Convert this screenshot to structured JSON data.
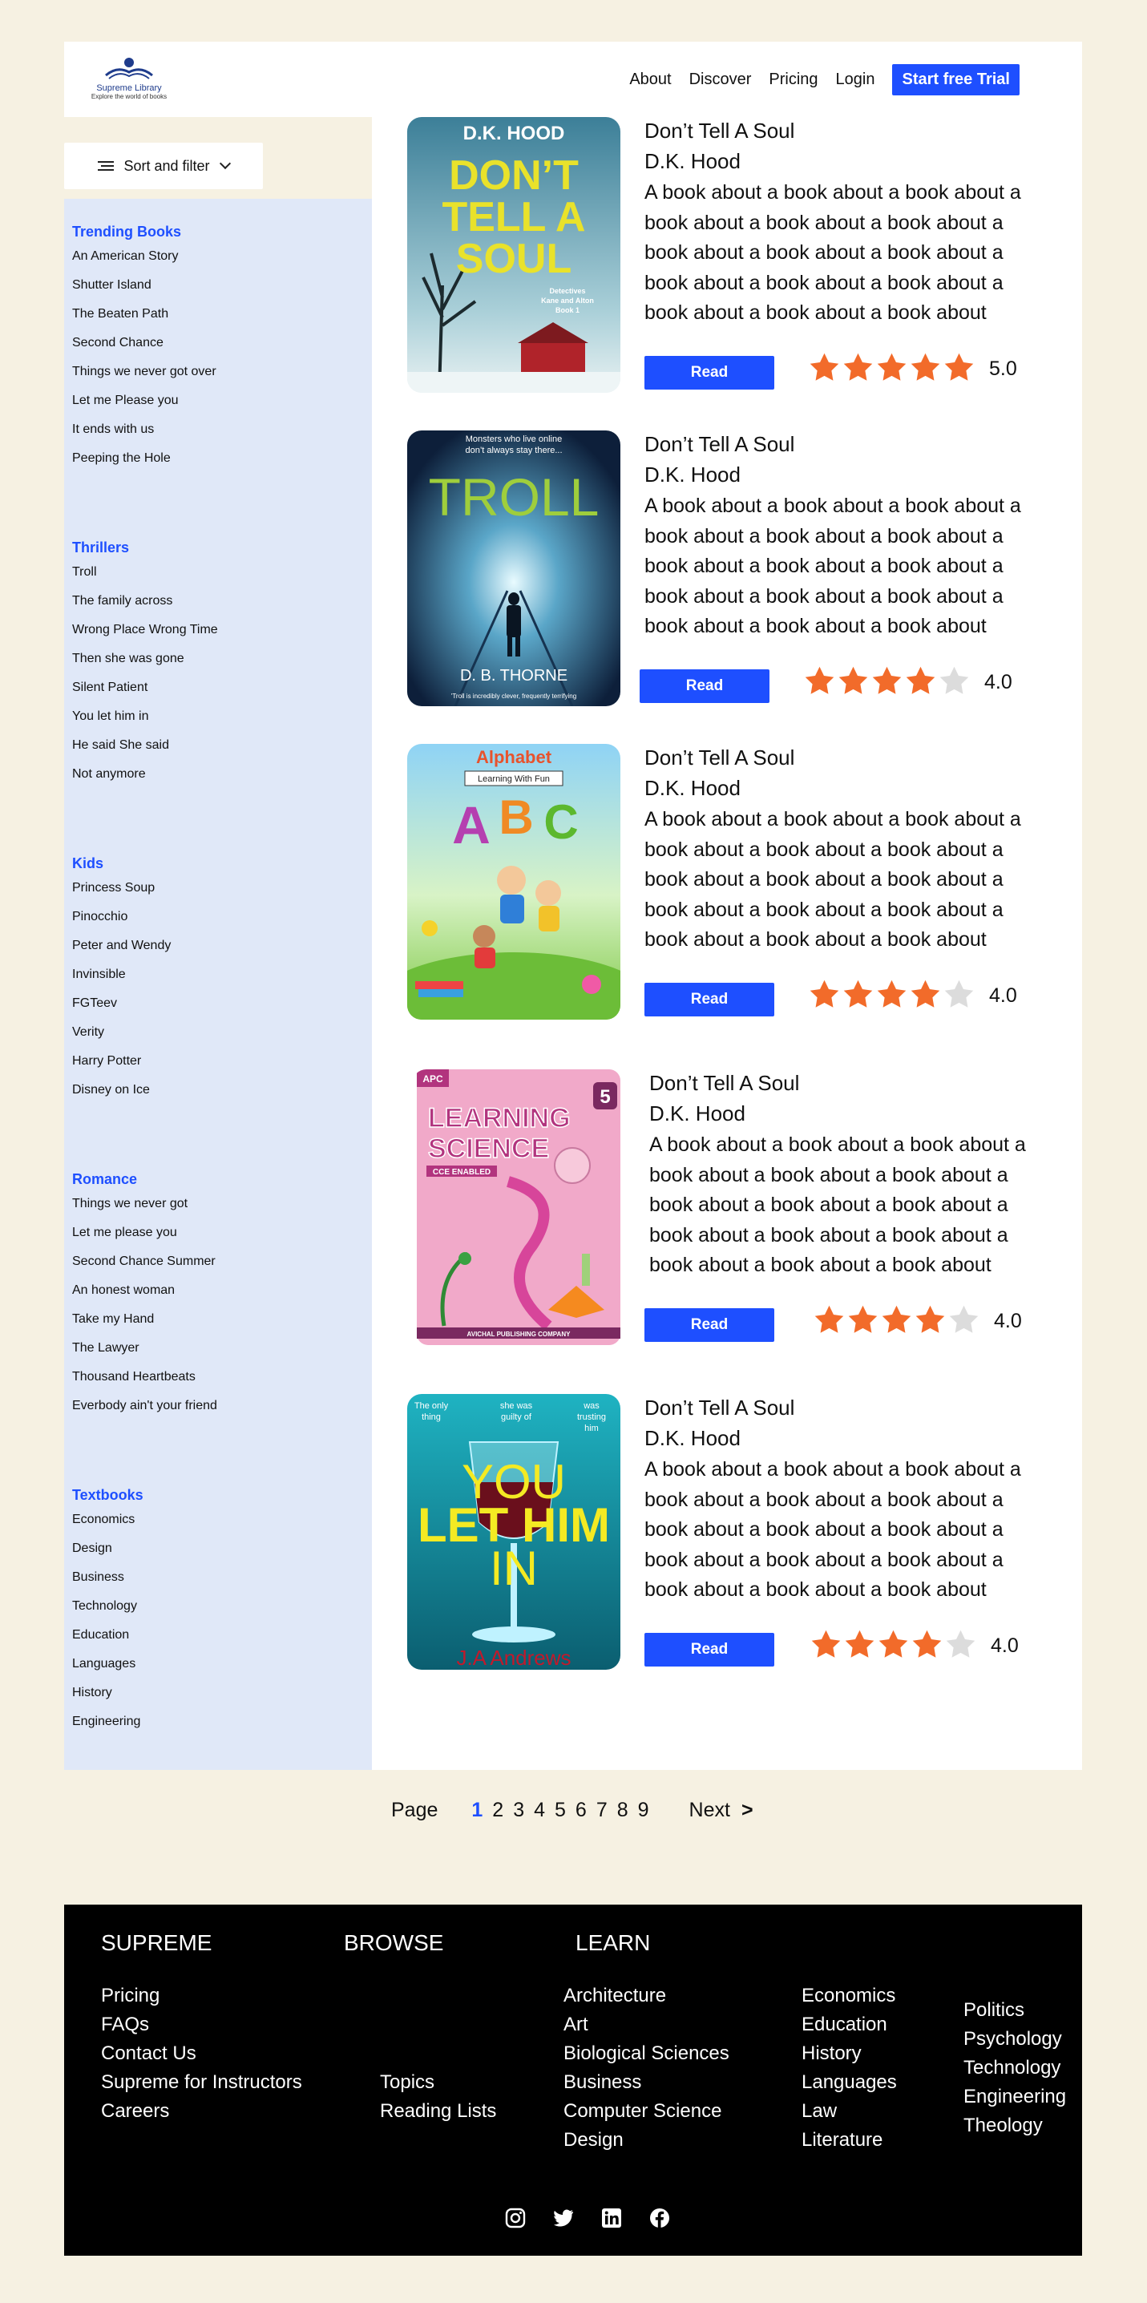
{
  "header": {
    "logo_name": "Supreme Library",
    "logo_tagline": "Explore the world of books",
    "nav": [
      "About",
      "Discover",
      "Pricing",
      "Login"
    ],
    "cta": "Start free Trial"
  },
  "sort": {
    "label": "Sort and filter"
  },
  "sidebar": {
    "categories": [
      {
        "title": "Trending Books",
        "items": [
          " An American Story",
          "Shutter  Island",
          "The Beaten Path",
          "Second Chance",
          "Things we never got over",
          "Let me Please you",
          "It ends with us",
          "Peeping the Hole"
        ]
      },
      {
        "title": "Thrillers",
        "items": [
          "Troll",
          "The family across",
          "Wrong Place Wrong Time",
          "Then she was gone",
          "Silent Patient",
          "You let him in",
          "He said She said",
          "Not anymore"
        ]
      },
      {
        "title": "Kids",
        "items": [
          "Princess Soup",
          "Pinocchio",
          "Peter and Wendy",
          "Invinsible",
          "FGTeev",
          "Verity",
          "Harry Potter",
          "Disney on Ice"
        ]
      },
      {
        "title": "Romance",
        "items": [
          "Things we never got",
          "Let me please you",
          "Second Chance Summer",
          "An honest woman",
          "Take my Hand",
          "The Lawyer",
          "Thousand Heartbeats",
          "Everbody ain't your friend"
        ]
      },
      {
        "title": "Textbooks",
        "items": [
          "Economics",
          "Design",
          "Business",
          "Technology",
          "Education",
          "Languages",
          "History",
          "Engineering"
        ]
      }
    ]
  },
  "books": [
    {
      "title": "Don’t Tell A Soul",
      "author": "D.K. Hood",
      "description": "A book about a book about a book about a book about a book about a book about a book about a book about a book about a book about a book about a book about a book about a book about a book about",
      "read_label": "Read",
      "rating": 5.0,
      "rating_text": "5.0",
      "cover": {
        "kind": "dont-tell",
        "author_text": "D.K. HOOD",
        "title_lines": [
          "DON’T",
          "TELL A",
          "SOUL"
        ],
        "subtitle_lines": [
          "Detectives",
          "Kane and Alton",
          "Book 1"
        ]
      }
    },
    {
      "title": "Don’t Tell A Soul",
      "author": "D.K. Hood",
      "description": "A book about a book about a book about a book about a book about a book about a book about a book about a book about a book about a book about a book about a book about a book about a book about",
      "read_label": "Read",
      "rating": 4.0,
      "rating_text": "4.0",
      "cover": {
        "kind": "troll",
        "top_lines": [
          "Monsters who live online",
          "don’t always stay there..."
        ],
        "title": "TROLL",
        "author_text": "D. B. THORNE",
        "quote": "'Troll is incredibly clever, frequently terrifying"
      }
    },
    {
      "title": "Don’t Tell A Soul",
      "author": "D.K. Hood",
      "description": "A book about a book about a book about a book about a book about a book about a book about a book about a book about a book about a book about a book about a book about a book about a book about",
      "read_label": "Read",
      "rating": 4.0,
      "rating_text": "4.0",
      "cover": {
        "kind": "abc",
        "top_title": "Alphabet",
        "sub": "Learning With Fun",
        "letters": [
          "A",
          "B",
          "C"
        ]
      }
    },
    {
      "title": "Don’t Tell A Soul",
      "author": "D.K. Hood",
      "description": "A book about a book about a book about a book about a book about a book about a book about a book about a book about a book about a book about a book about a book about a book about a book about",
      "read_label": "Read",
      "rating": 4.0,
      "rating_text": "4.0",
      "cover": {
        "kind": "science",
        "badge": "APC",
        "number": "5",
        "title_lines": [
          "LEARNING",
          "SCIENCE"
        ],
        "tag": "CCE ENABLED",
        "publisher": "AVICHAL PUBLISHING COMPANY"
      }
    },
    {
      "title": "Don’t Tell A Soul",
      "author": "D.K. Hood",
      "description": "A book about a book about a book about a book about a book about a book about a book about a book about a book about a book about a book about a book about a book about a book about a book about",
      "read_label": "Read",
      "rating": 4.0,
      "rating_text": "4.0",
      "cover": {
        "kind": "youlet",
        "top_left": [
          "The only",
          "thing"
        ],
        "top_mid": [
          "she was",
          "guilty of"
        ],
        "top_right": [
          "was",
          "trusting",
          "him"
        ],
        "title_lines": [
          "YOU",
          "LET HIM",
          "IN"
        ],
        "author_text": "J.A Andrews"
      }
    }
  ],
  "pagination": {
    "label": "Page",
    "pages": [
      "1",
      "2",
      "3",
      "4",
      "5",
      "6",
      "7",
      "8",
      "9"
    ],
    "current": "1",
    "next": "Next",
    "next_arrow": ">"
  },
  "footer": {
    "headings": [
      "SUPREME",
      "BROWSE",
      "LEARN"
    ],
    "supreme_links": [
      "Pricing",
      "FAQs",
      "Contact Us",
      "Supreme for Instructors",
      "Careers"
    ],
    "browse_links": [
      "Topics",
      "Reading Lists"
    ],
    "learn_col1": [
      "Architecture",
      "Art",
      "Biological Sciences",
      "Business",
      "Computer Science",
      "Design"
    ],
    "learn_col2": [
      "Economics",
      "Education",
      "History",
      "Languages",
      "Law",
      "Literature"
    ],
    "learn_col3": [
      "Politics",
      "Psychology",
      "Technology",
      "Engineering",
      "Theology"
    ],
    "social_icons": [
      "instagram-icon",
      "twitter-icon",
      "linkedin-icon",
      "facebook-icon"
    ]
  },
  "colors": {
    "background": "#f6f1e2",
    "accent": "#1e4fff",
    "sidebar": "#e0e8f8",
    "star_on": "#f26b2a",
    "star_off": "#dcdcdc",
    "footer": "#000000"
  }
}
